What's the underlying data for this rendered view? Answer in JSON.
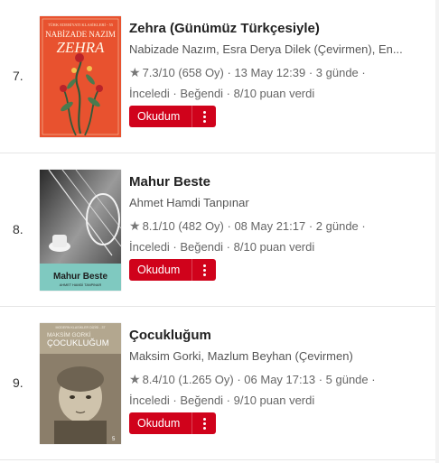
{
  "items": [
    {
      "rank": "7.",
      "title": "Zehra (Günümüz Türkçesiyle)",
      "authors": "Nabizade Nazım, Esra Derya Dilek (Çevirmen), En...",
      "rating": "7.3/10 (658 Oy)",
      "date": "13 May 12:39",
      "duration": "3 günde",
      "status": "İnceledi · Beğendi · 8/10 puan verdi",
      "button_label": "Okudum",
      "cover": {
        "series": "TÜRK EDEBİYATI KLASİKLERİ - 55",
        "author": "NABİZADE NAZIM",
        "title": "ZEHRA",
        "bg": "#e8522f"
      }
    },
    {
      "rank": "8.",
      "title": "Mahur Beste",
      "authors": "Ahmet Hamdi Tanpınar",
      "rating": "8.1/10 (482 Oy)",
      "date": "08 May 21:17",
      "duration": "2 günde",
      "status": "İnceledi · Beğendi · 8/10 puan verdi",
      "button_label": "Okudum",
      "cover": {
        "title": "Mahur Beste",
        "author": "AHMET HAMDİ TANPINAR",
        "band": "#7fc9c0"
      }
    },
    {
      "rank": "9.",
      "title": "Çocukluğum",
      "authors": "Maksim Gorki, Mazlum Beyhan (Çevirmen)",
      "rating": "8.4/10 (1.265 Oy)",
      "date": "06 May 17:13",
      "duration": "5 günde",
      "status": "İnceledi · Beğendi · 9/10 puan verdi",
      "button_label": "Okudum",
      "cover": {
        "series": "MODERN KLASİKLER DİZİSİ - 37",
        "author": "MAKSİM GORKİ",
        "title": "ÇOCUKLUĞUM",
        "bg": "#8b7e6a"
      }
    }
  ],
  "colors": {
    "accent": "#d0021b"
  },
  "icons": {
    "rating": "star-icon",
    "more": "more-vertical-icon"
  }
}
